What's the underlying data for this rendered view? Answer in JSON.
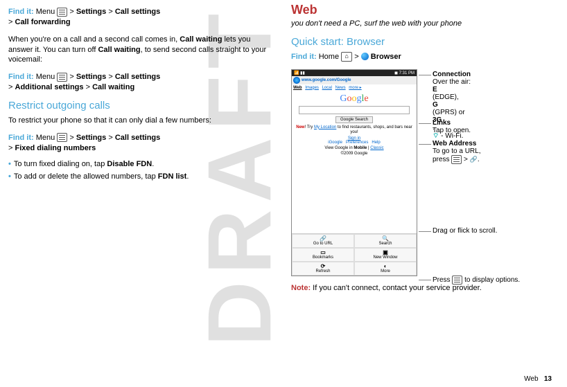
{
  "left": {
    "findit": "Find it:",
    "menu_word": "Menu",
    "sep": ">",
    "settings": "Settings",
    "call_settings": "Call settings",
    "call_forwarding": "Call forwarding",
    "para1a": "When you're on a call and a second call comes in, ",
    "call_waiting_b": "Call waiting",
    "para1b": " lets you answer it. You can turn off ",
    "para1c": ", to send second calls straight to your voicemail:",
    "additional_settings": "Additional settings",
    "call_waiting2": "Call waiting",
    "restrict_h": "Restrict outgoing calls",
    "restrict_p": "To restrict your phone so that it can only dial a few numbers:",
    "fixed_dialing": "Fixed dialing numbers",
    "li1a": "To turn fixed dialing on, tap ",
    "disable_fdn": "Disable FDN",
    "li1b": ".",
    "li2a": "To add or delete the allowed numbers, tap ",
    "fdn_list": "FDN list",
    "li2b": "."
  },
  "right": {
    "web_h": "Web",
    "subtitle": "you don't need a PC, surf the web with your phone",
    "quick_h": "Quick start: Browser",
    "findit": "Find it:",
    "home_word": "Home",
    "sep": ">",
    "browser": "Browser",
    "note_label": "Note:",
    "note_text": " If you can't connect, contact your service provider."
  },
  "phone": {
    "status_left": " ",
    "status_right": "7:31 PM",
    "url": "www.google.com/Google",
    "tabs": {
      "web": "Web",
      "images": "Images",
      "local": "Local",
      "news": "News",
      "more": "more ▸"
    },
    "btn": "Google Search",
    "hint_new": "New",
    "hint_a": "! Try ",
    "hint_link": "My Location",
    "hint_b": " to find restaurants, shops, and bars near you!",
    "signin": "Sign in",
    "footer": {
      "igoogle": "iGoogle",
      "prefs": "Preferences",
      "help": "Help"
    },
    "view_a": "View Google in ",
    "view_b": "Mobile",
    "view_c": " | ",
    "view_link": "Classic",
    "copy": "©2009 Google",
    "toolbar": {
      "goto": "Go to URL",
      "search": "Search",
      "bookmarks": "Bookmarks",
      "newwin": "New Window",
      "refresh": "Refresh",
      "more": "More"
    }
  },
  "annos": {
    "conn_h": "Connection",
    "conn_a": "Over the air:",
    "conn_b": " (EDGE), ",
    "conn_c": " (GPRS) or ",
    "conn_d": ".",
    "conn_e": " - Wi-Fi.",
    "edge": "E",
    "gprs": "G",
    "g3": "3G",
    "links_h": "Links",
    "links_t": "Tap to open.",
    "addr_h": "Web Address",
    "addr_a": "To go to a URL,",
    "addr_b": "press ",
    "drag": "Drag or flick to scroll.",
    "opt_a": "Press ",
    "opt_b": " to display options."
  },
  "footer": {
    "label": "Web",
    "page": "13"
  }
}
